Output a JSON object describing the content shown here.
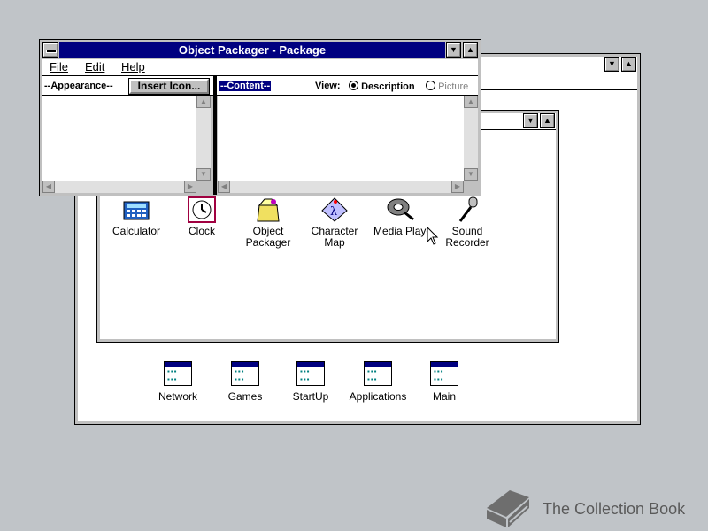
{
  "program_manager_window": {
    "icons": [
      {
        "label": "Network"
      },
      {
        "label": "Games"
      },
      {
        "label": "StartUp"
      },
      {
        "label": "Applications"
      },
      {
        "label": "Main"
      }
    ]
  },
  "accessories_window": {
    "icons": [
      {
        "label": "Calculator"
      },
      {
        "label": "Clock"
      },
      {
        "label": "Object Packager"
      },
      {
        "label": "Character Map"
      },
      {
        "label": "Media Player"
      },
      {
        "label": "Sound Recorder"
      }
    ]
  },
  "packager": {
    "title": "Object Packager - Package",
    "menu": {
      "file": "File",
      "edit": "Edit",
      "help": "Help"
    },
    "appearance_label": "--Appearance--",
    "insert_icon_button": "Insert Icon...",
    "content_label": "--Content--",
    "view_label": "View:",
    "view_options": {
      "description": "Description",
      "picture": "Picture"
    },
    "view_selected": "Description"
  },
  "watermark": {
    "text": "The Collection Book"
  },
  "colors": {
    "titlebar": "#000080",
    "desktop": "#c0c4c8",
    "window_frame": "#c0c0c0"
  }
}
